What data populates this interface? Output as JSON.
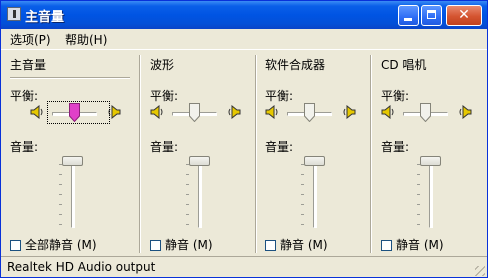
{
  "window": {
    "title": "主音量"
  },
  "menu": {
    "options": "选项(P)",
    "help": "帮助(H)"
  },
  "status": {
    "text": "Realtek HD Audio output"
  },
  "panels": [
    {
      "title": "主音量",
      "balance_label": "平衡:",
      "volume_label": "音量:",
      "mute_label": "全部静音 (M)",
      "balance": 0.5,
      "volume": 1.0,
      "mute_checked": false
    },
    {
      "title": "波形",
      "balance_label": "平衡:",
      "volume_label": "音量:",
      "mute_label": "静音 (M)",
      "balance": 0.5,
      "volume": 1.0,
      "mute_checked": false
    },
    {
      "title": "软件合成器",
      "balance_label": "平衡:",
      "volume_label": "音量:",
      "mute_label": "静音 (M)",
      "balance": 0.5,
      "volume": 1.0,
      "mute_checked": false
    },
    {
      "title": "CD 唱机",
      "balance_label": "平衡:",
      "volume_label": "音量:",
      "mute_label": "静音 (M)",
      "balance": 0.5,
      "volume": 1.0,
      "mute_checked": false
    }
  ],
  "colors": {
    "title_bar": "#0054e3",
    "face": "#ece9d8",
    "focused_thumb": "#e040c8",
    "speaker": "#e6c800"
  }
}
